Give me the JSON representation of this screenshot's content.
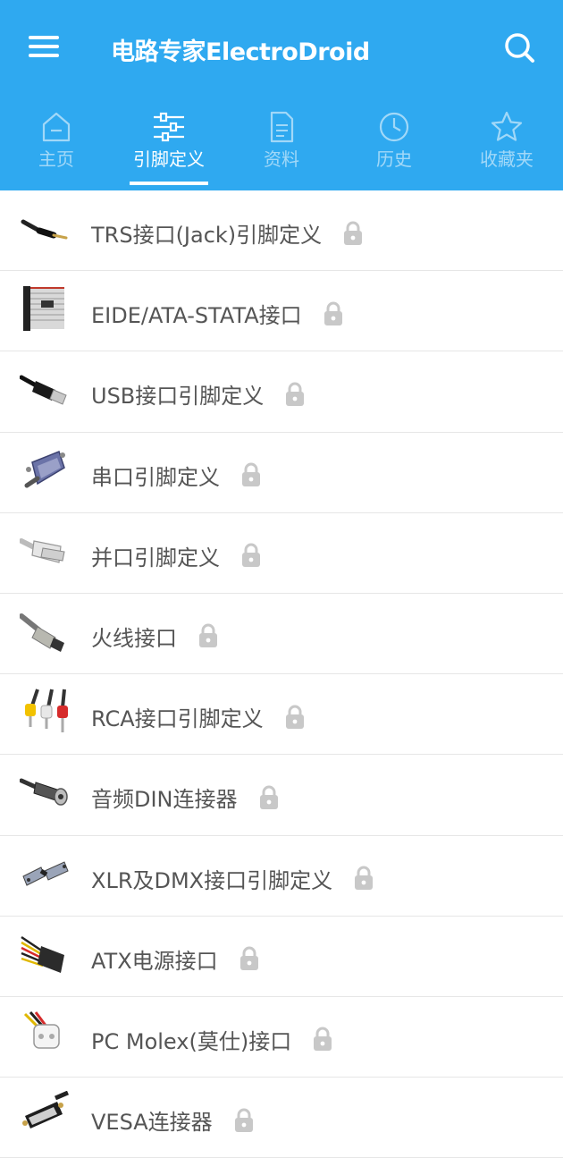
{
  "app": {
    "title": "电路专家ElectroDroid",
    "accent_color": "#2FA9F0"
  },
  "tabs": [
    {
      "label": "主页",
      "icon": "home-icon",
      "active": false
    },
    {
      "label": "引脚定义",
      "icon": "sliders-icon",
      "active": true
    },
    {
      "label": "资料",
      "icon": "document-icon",
      "active": false
    },
    {
      "label": "历史",
      "icon": "clock-icon",
      "active": false
    },
    {
      "label": "收藏夹",
      "icon": "star-icon",
      "active": false
    }
  ],
  "items": [
    {
      "label": "TRS接口(Jack)引脚定义",
      "thumb": "trs-jack-plug-image",
      "locked": true
    },
    {
      "label": "EIDE/ATA-STATA接口",
      "thumb": "ide-ribbon-cable-image",
      "locked": true
    },
    {
      "label": "USB接口引脚定义",
      "thumb": "usb-plug-image",
      "locked": true
    },
    {
      "label": "串口引脚定义",
      "thumb": "serial-db9-plug-image",
      "locked": true
    },
    {
      "label": "并口引脚定义",
      "thumb": "parallel-db25-plug-image",
      "locked": true
    },
    {
      "label": "火线接口",
      "thumb": "firewire-plug-image",
      "locked": true
    },
    {
      "label": "RCA接口引脚定义",
      "thumb": "rca-plugs-image",
      "locked": true
    },
    {
      "label": "音频DIN连接器",
      "thumb": "din-plug-image",
      "locked": true
    },
    {
      "label": "XLR及DMX接口引脚定义",
      "thumb": "xlr-plugs-image",
      "locked": true
    },
    {
      "label": "ATX电源接口",
      "thumb": "atx-power-connector-image",
      "locked": true
    },
    {
      "label": "PC Molex(莫仕)接口",
      "thumb": "molex-connector-image",
      "locked": true
    },
    {
      "label": "VESA连接器",
      "thumb": "vesa-dvi-plug-image",
      "locked": true
    }
  ]
}
